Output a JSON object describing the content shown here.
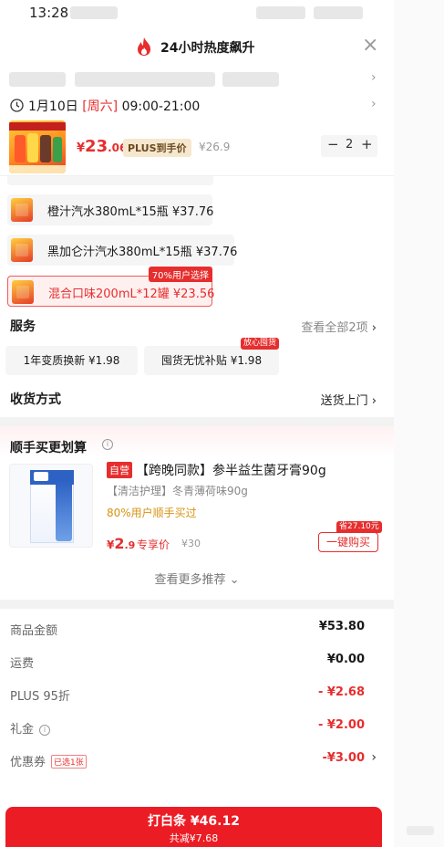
{
  "status_bar": {
    "time": "13:28"
  },
  "header": {
    "title": "24小时热度飙升"
  },
  "delivery_time": {
    "date": "1月10日",
    "weekday": "[周六]",
    "hours": "09:00-21:00"
  },
  "product": {
    "price_symbol": "¥",
    "price_int": "23",
    "price_dec": ".06",
    "plus_label": "PLUS到手价",
    "original_price": "¥26.9",
    "quantity": "2",
    "minus": "−",
    "plus": "+"
  },
  "variants": [
    {
      "label": "橙汁汽水380mL*15瓶  ¥37.76"
    },
    {
      "label": "黑加仑汁汽水380mL*15瓶  ¥37.76"
    },
    {
      "label": "混合口味200mL*12罐  ¥23.56",
      "tag": "70%用户选择"
    }
  ],
  "services": {
    "title": "服务",
    "view_all": "查看全部2项",
    "items": [
      {
        "label": "1年变质换新 ¥1.98"
      },
      {
        "label": "囤货无忧补贴 ¥1.98",
        "badge": "放心囤货"
      }
    ]
  },
  "shipping": {
    "title": "收货方式",
    "value": "送货上门"
  },
  "recommend": {
    "title": "顺手买更划算",
    "self_tag": "自营",
    "name": "【跨晚同款】参半益生菌牙膏90g",
    "spec": "【清洁护理】冬青薄荷味90g",
    "percent": "80%用户顺手买过",
    "price_symbol": "¥",
    "price_int": "2",
    "price_dec": ".9",
    "exclusive": "专享价",
    "original_price": "¥30",
    "save_tag": "省27.10元",
    "buy_label": "一键购买",
    "more_label": "查看更多推荐 ⌄"
  },
  "summary": {
    "goods_label": "商品金额",
    "goods_value": "¥53.80",
    "freight_label": "运费",
    "freight_value": "¥0.00",
    "plus_label": "PLUS 95折",
    "plus_value": "- ¥2.68",
    "gift_label": "礼金",
    "gift_value": "- ¥2.00",
    "coupon_label": "优惠券",
    "coupon_tag": "已选1张",
    "coupon_value": "-¥3.00"
  },
  "pay": {
    "label": "打白条 ¥46.12",
    "saving": "共减¥7.68"
  },
  "colors": {
    "accent": "#ec1c24",
    "plus_gold": "#f6e7cf",
    "highlight_orange": "#d89312"
  },
  "icons": [
    "flame-icon",
    "close-icon",
    "clock-icon",
    "chevron-right-icon",
    "info-icon"
  ]
}
